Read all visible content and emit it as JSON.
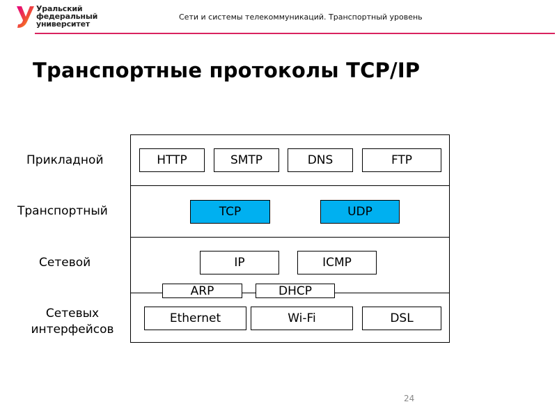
{
  "header": {
    "logo": {
      "icon": "urfu-logo-icon",
      "lines": [
        "Уральский",
        "федеральный",
        "университет"
      ]
    },
    "caption": "Сети и системы телекоммуникаций. Транспортный уровень",
    "accent_color": "#d9235f"
  },
  "slide": {
    "title": "Транспортные протоколы TCP/IP",
    "page_number": "24"
  },
  "diagram": {
    "highlight_color": "#00b0f0",
    "layers": [
      {
        "name": "Прикладной",
        "protocols": [
          "HTTP",
          "SMTP",
          "DNS",
          "FTP"
        ]
      },
      {
        "name": "Транспортный",
        "protocols": [
          "TCP",
          "UDP"
        ],
        "highlighted": true
      },
      {
        "name": "Сетевой",
        "protocols": [
          "IP",
          "ICMP"
        ]
      },
      {
        "name_lines": [
          "Сетевых",
          "интерфейсов"
        ],
        "protocols": [
          "Ethernet",
          "Wi-Fi",
          "DSL"
        ]
      }
    ],
    "boundary_protocols": [
      "ARP",
      "DHCP"
    ]
  }
}
